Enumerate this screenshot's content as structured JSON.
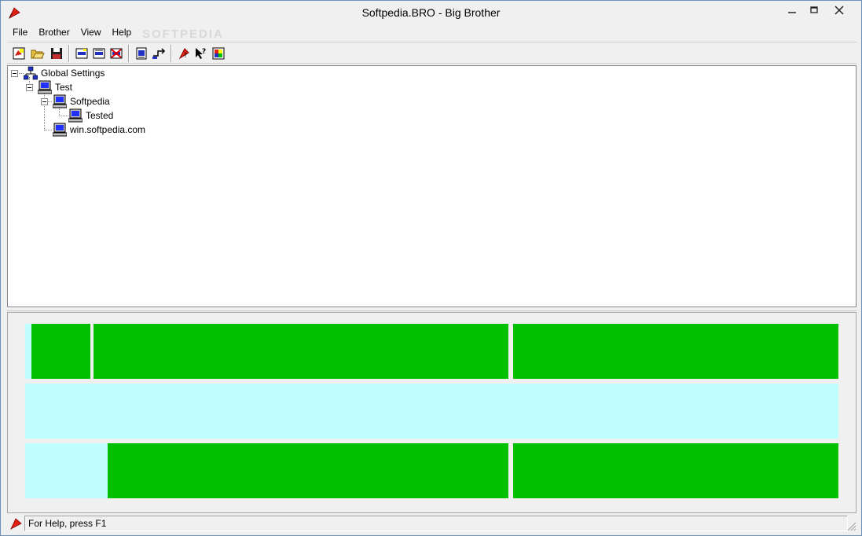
{
  "window": {
    "title": "Softpedia.BRO - Big Brother"
  },
  "menu": {
    "items": [
      {
        "label": "File"
      },
      {
        "label": "Brother"
      },
      {
        "label": "View"
      },
      {
        "label": "Help"
      }
    ]
  },
  "watermark": "SOFTPEDIA",
  "tree": {
    "root": "Global Settings",
    "nodes": [
      {
        "label": "Test"
      },
      {
        "label": "Softpedia"
      },
      {
        "label": "Tested"
      },
      {
        "label": "win.softpedia.com"
      }
    ]
  },
  "status": {
    "text": "For Help, press F1"
  },
  "colors": {
    "ok": "#00c000",
    "empty": "#c0ffff"
  }
}
